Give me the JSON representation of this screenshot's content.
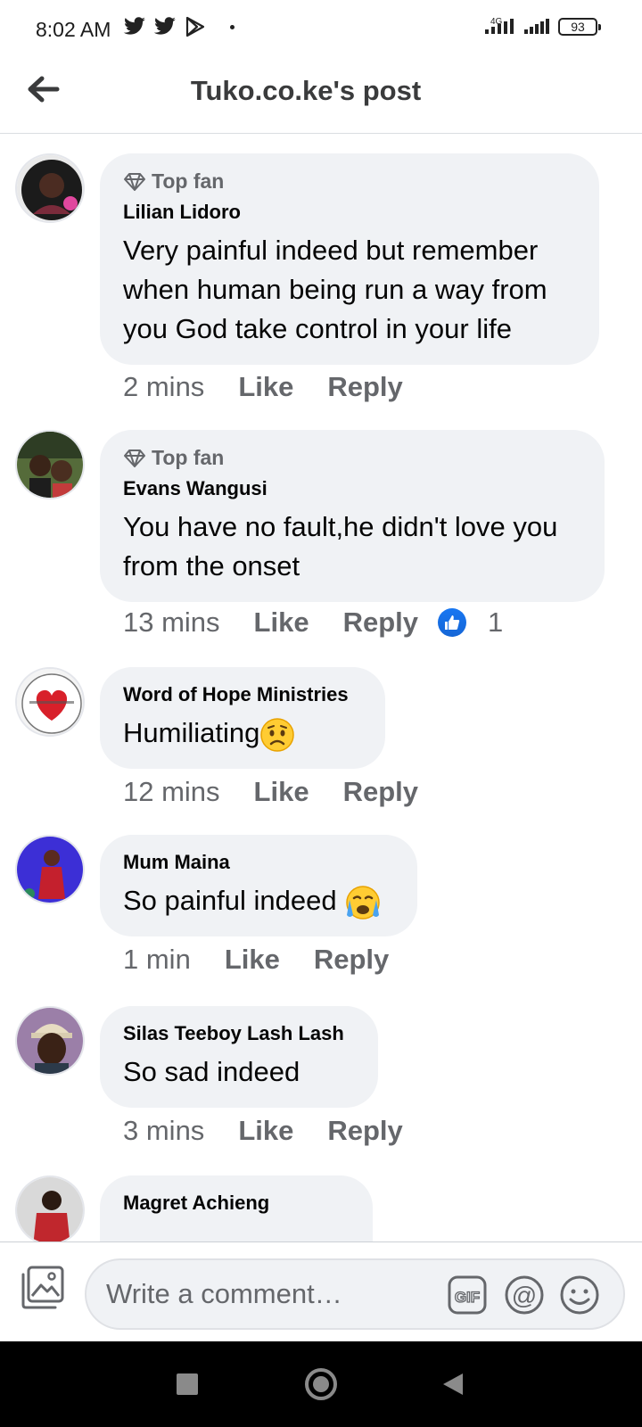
{
  "status_bar": {
    "time": "8:02 AM",
    "network": "4G",
    "battery": "93"
  },
  "header": {
    "title": "Tuko.co.ke's post",
    "back_icon": "arrow-left-icon"
  },
  "comments": [
    {
      "badge": "Top fan",
      "author": "Lilian Lidoro",
      "text": "Very painful indeed but remember when human being run a way from you God take control in your life",
      "time": "2 mins",
      "like": "Like",
      "reply": "Reply",
      "avatar_color": "#3b2a26",
      "avatar_caption": "Profile photo"
    },
    {
      "badge": "Top fan",
      "author": "Evans Wangusi",
      "text": "You have no fault,he didn't love you from the onset",
      "time": "13 mins",
      "like": "Like",
      "reply": "Reply",
      "reactions": "1",
      "avatar_color": "#2f4a2a"
    },
    {
      "author": "Word of Hope Ministries",
      "text": "Humiliating",
      "emoji": "worried-face",
      "time": "12 mins",
      "like": "Like",
      "reply": "Reply",
      "avatar_color": "#d8202a"
    },
    {
      "author": "Mum Maina",
      "text": "So painful indeed",
      "emoji": "crying-face",
      "time": "1 min",
      "like": "Like",
      "reply": "Reply",
      "avatar_color": "#3c2fd6"
    },
    {
      "author": "Silas Teeboy Lash Lash",
      "text": "So sad indeed",
      "time": "3 mins",
      "like": "Like",
      "reply": "Reply",
      "avatar_color": "#6b4a3a"
    },
    {
      "author": "Magret Achieng",
      "avatar_color": "#c0272d"
    }
  ],
  "composer": {
    "placeholder": "Write a comment…",
    "gif_label": "GIF",
    "mention_label": "@"
  },
  "colors": {
    "bubble": "#f0f2f5",
    "secondary_text": "#65676b",
    "like_blue": "#1877f2"
  }
}
